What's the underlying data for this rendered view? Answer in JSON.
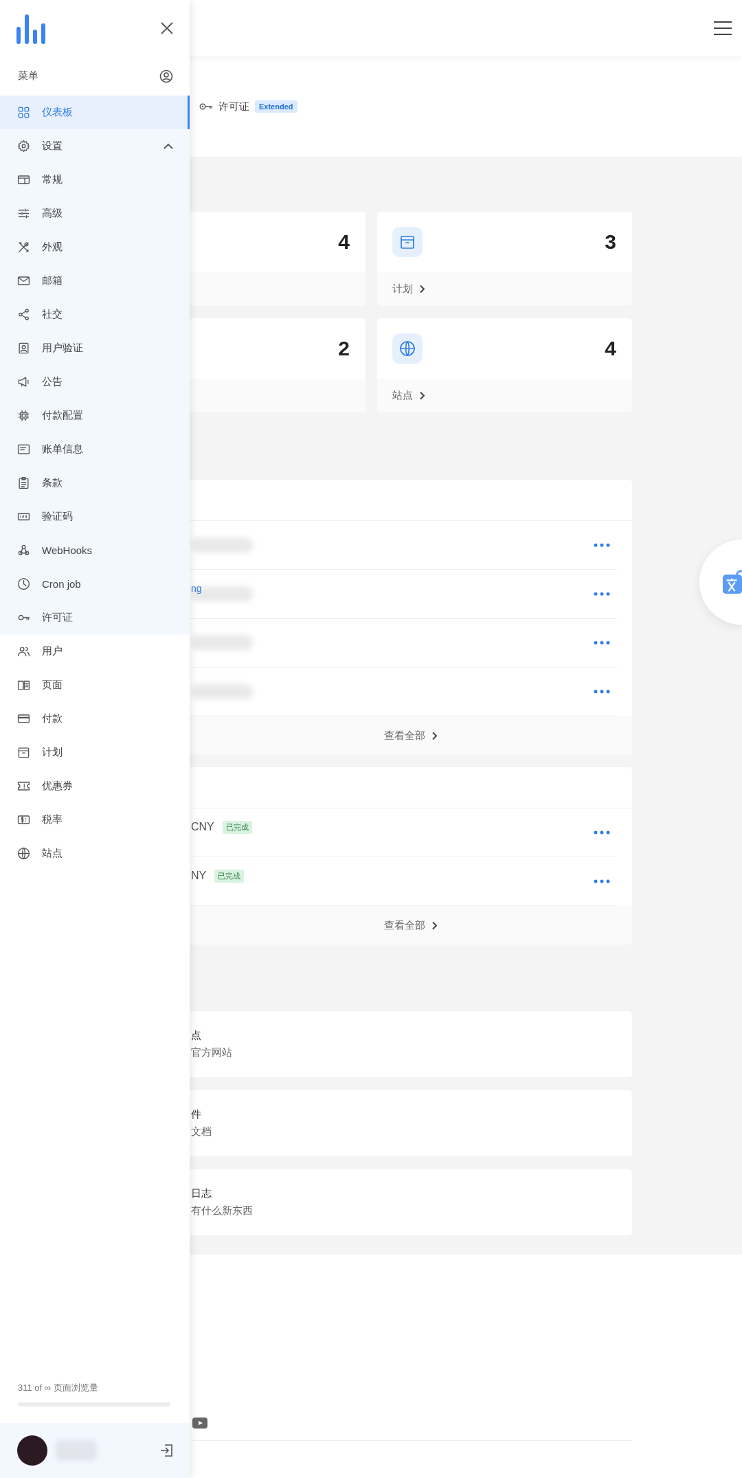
{
  "sidebar": {
    "menu_title": "菜单",
    "items": [
      {
        "label": "仪表板",
        "kind": "grid",
        "selected": true
      },
      {
        "label": "设置",
        "kind": "gear",
        "selected": false,
        "expanded": true,
        "children": [
          {
            "label": "常规",
            "kind": "window",
            "selected": false
          },
          {
            "label": "高级",
            "kind": "sliders",
            "selected": false
          },
          {
            "label": "外观",
            "kind": "tools",
            "selected": false
          },
          {
            "label": "邮箱",
            "kind": "mail",
            "selected": false
          },
          {
            "label": "社交",
            "kind": "share",
            "selected": false
          },
          {
            "label": "用户验证",
            "kind": "badge",
            "selected": false
          },
          {
            "label": "公告",
            "kind": "megaphone",
            "selected": false
          },
          {
            "label": "付款配置",
            "kind": "chip",
            "selected": false
          },
          {
            "label": "账单信息",
            "kind": "receipt",
            "selected": false
          },
          {
            "label": "条款",
            "kind": "clipboard",
            "selected": false
          },
          {
            "label": "验证码",
            "kind": "numbers",
            "selected": false
          },
          {
            "label": "WebHooks",
            "kind": "webhook",
            "selected": false
          },
          {
            "label": "Cron job",
            "kind": "clock",
            "selected": false
          },
          {
            "label": "许可证",
            "kind": "key",
            "selected": false
          }
        ]
      },
      {
        "label": "用户",
        "kind": "users",
        "selected": false
      },
      {
        "label": "页面",
        "kind": "book",
        "selected": false
      },
      {
        "label": "付款",
        "kind": "card",
        "selected": false
      },
      {
        "label": "计划",
        "kind": "box",
        "selected": false
      },
      {
        "label": "优惠券",
        "kind": "ticket",
        "selected": false
      },
      {
        "label": "税率",
        "kind": "dollar",
        "selected": false
      },
      {
        "label": "站点",
        "kind": "globe",
        "selected": false
      }
    ],
    "usage": {
      "text": "311 of ∞ 页面浏览量",
      "level": 0
    }
  },
  "license": {
    "label": "许可证",
    "badge": "Extended"
  },
  "stats": [
    {
      "kind": "plain",
      "value": "4"
    },
    {
      "kind": "box",
      "value": "3",
      "label": "计划"
    },
    {
      "kind": "plain",
      "value": "2"
    },
    {
      "kind": "globe",
      "value": "4",
      "label": "站点"
    }
  ],
  "recent_list": {
    "rows": [
      {
        "kind": "blurred"
      },
      {
        "kind": "link",
        "link": "ng"
      },
      {
        "kind": "blurred"
      },
      {
        "kind": "blurred"
      }
    ],
    "footer": "查看全部"
  },
  "payments": {
    "rows": [
      {
        "amount": "CNY",
        "status": "已完成"
      },
      {
        "amount": "NY",
        "status": "已完成"
      }
    ],
    "footer": "查看全部"
  },
  "quick_links": [
    {
      "title": "点",
      "subtitle": "官方网站"
    },
    {
      "title": "件",
      "subtitle": "文档"
    },
    {
      "title": "日志",
      "subtitle": "有什么新东西"
    }
  ]
}
